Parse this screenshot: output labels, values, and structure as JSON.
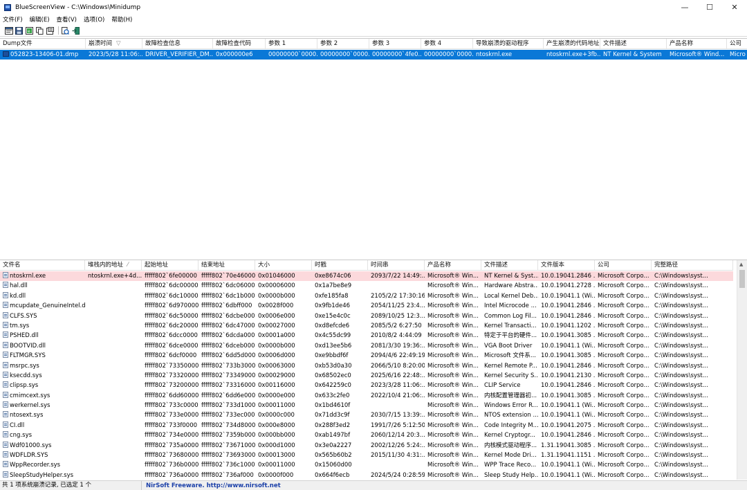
{
  "window": {
    "title": "BlueScreenView  -  C:\\Windows\\Minidump",
    "minimize_glyph": "—",
    "maximize_glyph": "☐",
    "close_glyph": "✕"
  },
  "menu": {
    "items": [
      {
        "label": "文件(F)"
      },
      {
        "label": "编辑(E)"
      },
      {
        "label": "查看(V)"
      },
      {
        "label": "选项(O)"
      },
      {
        "label": "帮助(H)"
      }
    ]
  },
  "toolbar": {
    "buttons": [
      {
        "icon": "options-icon"
      },
      {
        "icon": "save-icon"
      },
      {
        "icon": "html-report-icon"
      },
      {
        "icon": "copy-icon"
      },
      {
        "icon": "properties-icon"
      },
      {
        "icon": "refresh-icon"
      },
      {
        "icon": "exit-icon"
      }
    ]
  },
  "crash_list": {
    "columns": [
      {
        "label": "Dump文件"
      },
      {
        "label": "崩溃时间",
        "sort": "▽"
      },
      {
        "label": "故障检查信息"
      },
      {
        "label": "故障检查代码"
      },
      {
        "label": "参数 1"
      },
      {
        "label": "参数 2"
      },
      {
        "label": "参数 3"
      },
      {
        "label": "参数 4"
      },
      {
        "label": "导致崩溃的驱动程序"
      },
      {
        "label": "产生崩溃的代码地址"
      },
      {
        "label": "文件描述"
      },
      {
        "label": "产品名称"
      },
      {
        "label": "公司"
      }
    ],
    "rows": [
      {
        "selected": true,
        "cells": [
          "052823-13406-01.dmp",
          "2023/5/28 11:06:...",
          "DRIVER_VERIFIER_DM...",
          "0x000000e6",
          "00000000`0000...",
          "00000000`0000...",
          "00000000`4fe0...",
          "00000000`0000...",
          "ntoskrnl.exe",
          "ntoskrnl.exe+3fb...",
          "NT Kernel & System",
          "Microsoft® Wind...",
          "Micro"
        ]
      }
    ]
  },
  "module_list": {
    "columns": [
      {
        "label": "文件名"
      },
      {
        "label": "堆栈内的地址",
        "sort": "⁄"
      },
      {
        "label": "起始地址"
      },
      {
        "label": "结束地址"
      },
      {
        "label": "大小"
      },
      {
        "label": "时戳"
      },
      {
        "label": "时间串"
      },
      {
        "label": "产品名称"
      },
      {
        "label": "文件描述"
      },
      {
        "label": "文件版本"
      },
      {
        "label": "公司"
      },
      {
        "label": "完整路径"
      }
    ],
    "rows": [
      {
        "highlight": true,
        "cells": [
          "ntoskrnl.exe",
          "ntoskrnl.exe+4d...",
          "fffff802`6fe00000",
          "fffff802`70e46000",
          "0x01046000",
          "0xe8674c06",
          "2093/7/22 14:49:...",
          "Microsoft® Win...",
          "NT Kernel & Syst...",
          "10.0.19041.2846 ...",
          "Microsoft Corpo...",
          "C:\\Windows\\syst..."
        ]
      },
      {
        "cells": [
          "hal.dll",
          "",
          "fffff802`6dc00000",
          "fffff802`6dc06000",
          "0x00006000",
          "0x1a7be8e9",
          "",
          "Microsoft® Win...",
          "Hardware Abstra...",
          "10.0.19041.2728 ...",
          "Microsoft Corpo...",
          "C:\\Windows\\syst..."
        ]
      },
      {
        "cells": [
          "kd.dll",
          "",
          "fffff802`6dc10000",
          "fffff802`6dc1b000",
          "0x0000b000",
          "0xfe185fa8",
          "2105/2/2 17:30:16",
          "Microsoft® Win...",
          "Local Kernel Deb...",
          "10.0.19041.1 (Wi...",
          "Microsoft Corpo...",
          "C:\\Windows\\syst..."
        ]
      },
      {
        "cells": [
          "mcupdate_GenuineIntel.dll",
          "",
          "fffff802`6d970000",
          "fffff802`6dbff000",
          "0x0028f000",
          "0x9fb1de46",
          "2054/11/25 23:4...",
          "Microsoft® Win...",
          "Intel Microcode ...",
          "10.0.19041.2846 ...",
          "Microsoft Corpo...",
          "C:\\Windows\\syst..."
        ]
      },
      {
        "cells": [
          "CLFS.SYS",
          "",
          "fffff802`6dc50000",
          "fffff802`6dcbe000",
          "0x0006e000",
          "0xe15e4c0c",
          "2089/10/25 12:3...",
          "Microsoft® Win...",
          "Common Log Fil...",
          "10.0.19041.2846 ...",
          "Microsoft Corpo...",
          "C:\\Windows\\syst..."
        ]
      },
      {
        "cells": [
          "tm.sys",
          "",
          "fffff802`6dc20000",
          "fffff802`6dc47000",
          "0x00027000",
          "0xd8efcde6",
          "2085/5/2 6:27:50",
          "Microsoft® Win...",
          "Kernel Transacti...",
          "10.0.19041.1202 ...",
          "Microsoft Corpo...",
          "C:\\Windows\\syst..."
        ]
      },
      {
        "cells": [
          "PSHED.dll",
          "",
          "fffff802`6dcc0000",
          "fffff802`6dcda000",
          "0x0001a000",
          "0x4c55dc99",
          "2010/8/2 4:44:09",
          "Microsoft® Win...",
          "特定于平台的硬件...",
          "10.0.19041.3085 ...",
          "Microsoft Corpo...",
          "C:\\Windows\\syst..."
        ]
      },
      {
        "cells": [
          "BOOTVID.dll",
          "",
          "fffff802`6dce0000",
          "fffff802`6dceb000",
          "0x0000b000",
          "0xd13ee5b6",
          "2081/3/30 19:36:...",
          "Microsoft® Win...",
          "VGA Boot Driver",
          "10.0.19041.1 (Wi...",
          "Microsoft Corpo...",
          "C:\\Windows\\syst..."
        ]
      },
      {
        "cells": [
          "FLTMGR.SYS",
          "",
          "fffff802`6dcf0000",
          "fffff802`6dd5d000",
          "0x0006d000",
          "0xe9bbdf6f",
          "2094/4/6 22:49:19",
          "Microsoft® Win...",
          "Microsoft 文件系...",
          "10.0.19041.3085 ...",
          "Microsoft Corpo...",
          "C:\\Windows\\syst..."
        ]
      },
      {
        "cells": [
          "msrpc.sys",
          "",
          "fffff802`73350000",
          "fffff802`733b3000",
          "0x00063000",
          "0xb53d0a30",
          "2066/5/10 8:20:00",
          "Microsoft® Win...",
          "Kernel Remote P...",
          "10.0.19041.2846 ...",
          "Microsoft Corpo...",
          "C:\\Windows\\syst..."
        ]
      },
      {
        "cells": [
          "ksecdd.sys",
          "",
          "fffff802`73320000",
          "fffff802`73349000",
          "0x00029000",
          "0x68502ec0",
          "2025/6/16 22:48:...",
          "Microsoft® Win...",
          "Kernel Security S...",
          "10.0.19041.2130 ...",
          "Microsoft Corpo...",
          "C:\\Windows\\syst..."
        ]
      },
      {
        "cells": [
          "clipsp.sys",
          "",
          "fffff802`73200000",
          "fffff802`73316000",
          "0x00116000",
          "0x642259c0",
          "2023/3/28 11:06:...",
          "Microsoft® Win...",
          "CLIP Service",
          "10.0.19041.2846 ...",
          "Microsoft Corpo...",
          "C:\\Windows\\syst..."
        ]
      },
      {
        "cells": [
          "cmimcext.sys",
          "",
          "fffff802`6dd60000",
          "fffff802`6dd6e000",
          "0x0000e000",
          "0x633c2fe0",
          "2022/10/4 21:06:...",
          "Microsoft® Win...",
          "内核配置管理器初...",
          "10.0.19041.3085 ...",
          "Microsoft Corpo...",
          "C:\\Windows\\syst..."
        ]
      },
      {
        "cells": [
          "werkernel.sys",
          "",
          "fffff802`733c0000",
          "fffff802`733d1000",
          "0x00011000",
          "0x1bd4610f",
          "",
          "Microsoft® Win...",
          "Windows Error R...",
          "10.0.19041.1 (Wi...",
          "Microsoft Corpo...",
          "C:\\Windows\\syst..."
        ]
      },
      {
        "cells": [
          "ntosext.sys",
          "",
          "fffff802`733e0000",
          "fffff802`733ec000",
          "0x0000c000",
          "0x71dd3c9f",
          "2030/7/15 13:39:...",
          "Microsoft® Win...",
          "NTOS extension ...",
          "10.0.19041.1 (Wi...",
          "Microsoft Corpo...",
          "C:\\Windows\\syst..."
        ]
      },
      {
        "cells": [
          "CI.dll",
          "",
          "fffff802`733f0000",
          "fffff802`734d8000",
          "0x000e8000",
          "0x288f3ed2",
          "1991/7/26 5:12:50",
          "Microsoft® Win...",
          "Code Integrity M...",
          "10.0.19041.2075 ...",
          "Microsoft Corpo...",
          "C:\\Windows\\syst..."
        ]
      },
      {
        "cells": [
          "cng.sys",
          "",
          "fffff802`734e0000",
          "fffff802`7359b000",
          "0x000bb000",
          "0xab1497bf",
          "2060/12/14 20:3...",
          "Microsoft® Win...",
          "Kernel Cryptogr...",
          "10.0.19041.2846 ...",
          "Microsoft Corpo...",
          "C:\\Windows\\syst..."
        ]
      },
      {
        "cells": [
          "Wdf01000.sys",
          "",
          "fffff802`735a0000",
          "fffff802`73671000",
          "0x000d1000",
          "0x3e0a2227",
          "2002/12/26 5:24:...",
          "Microsoft® Win...",
          "内核模式驱动程序...",
          "1.31.19041.3085 ...",
          "Microsoft Corpo...",
          "C:\\Windows\\syst..."
        ]
      },
      {
        "cells": [
          "WDFLDR.SYS",
          "",
          "fffff802`73680000",
          "fffff802`73693000",
          "0x00013000",
          "0x565b60b2",
          "2015/11/30 4:31:...",
          "Microsoft® Win...",
          "Kernel Mode Dri...",
          "1.31.19041.1151 ...",
          "Microsoft Corpo...",
          "C:\\Windows\\syst..."
        ]
      },
      {
        "cells": [
          "WppRecorder.sys",
          "",
          "fffff802`736b0000",
          "fffff802`736c1000",
          "0x00011000",
          "0x15060d00",
          "",
          "Microsoft® Win...",
          "WPP Trace Reco...",
          "10.0.19041.1 (Wi...",
          "Microsoft Corpo...",
          "C:\\Windows\\syst..."
        ]
      },
      {
        "cells": [
          "SleepStudyHelper.sys",
          "",
          "fffff802`736a0000",
          "fffff802`736af000",
          "0x0000f000",
          "0x664f6ecb",
          "2024/5/24 0:28:59",
          "Microsoft® Win...",
          "Sleep Study Help...",
          "10.0.19041.1 (Wi...",
          "Microsoft Corpo...",
          "C:\\Windows\\syst..."
        ]
      }
    ]
  },
  "status": {
    "left": "共 1 项系统崩溃记录, 已选定 1 个",
    "link": "NirSoft Freeware.  http://www.nirsoft.net"
  },
  "colors": {
    "selection": "#0a78d7",
    "highlight": "#fcd9dc",
    "link": "#1a3fa8"
  }
}
